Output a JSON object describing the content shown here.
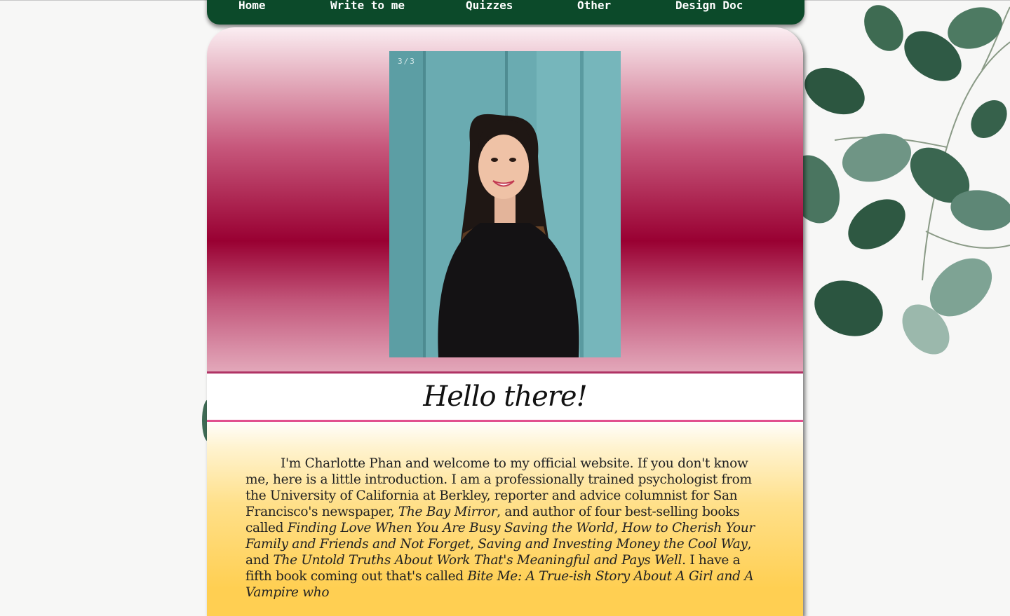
{
  "nav": {
    "items": [
      "Home",
      "Write to me",
      "Quizzes",
      "Other",
      "Design Doc"
    ]
  },
  "slideshow": {
    "counter": "3/3"
  },
  "greeting": {
    "heading": "Hello there!"
  },
  "intro": {
    "t1": "I'm Charlotte Phan and welcome to my official website. If you don't know me, here is a little introduction. I am a professionally trained psychologist from the University of California at Berkley, reporter and advice columnist for San Francisco's newspaper, ",
    "newspaper": "The Bay Mirror",
    "t2": ", and author of four best-selling books called ",
    "book1": "Finding Love When You Are Busy Saving the World",
    "t3": ", ",
    "book2": "How to Cherish Your Family and Friends and Not Forget",
    "t4": ", ",
    "book3": "Saving and Investing Money the Cool Way",
    "t5": ", and ",
    "book4": "The Untold Truths About Work That's Meaningful and Pays Well",
    "t6": ". I have a fifth book coming out that's called ",
    "book5": "Bite Me: A True-ish Story About A Girl and A Vampire who"
  },
  "colors": {
    "nav_bg": "#0c4a2a",
    "accent_magenta": "#990032",
    "accent_gold": "#ffcf52",
    "divider_pink": "#e1508e"
  }
}
